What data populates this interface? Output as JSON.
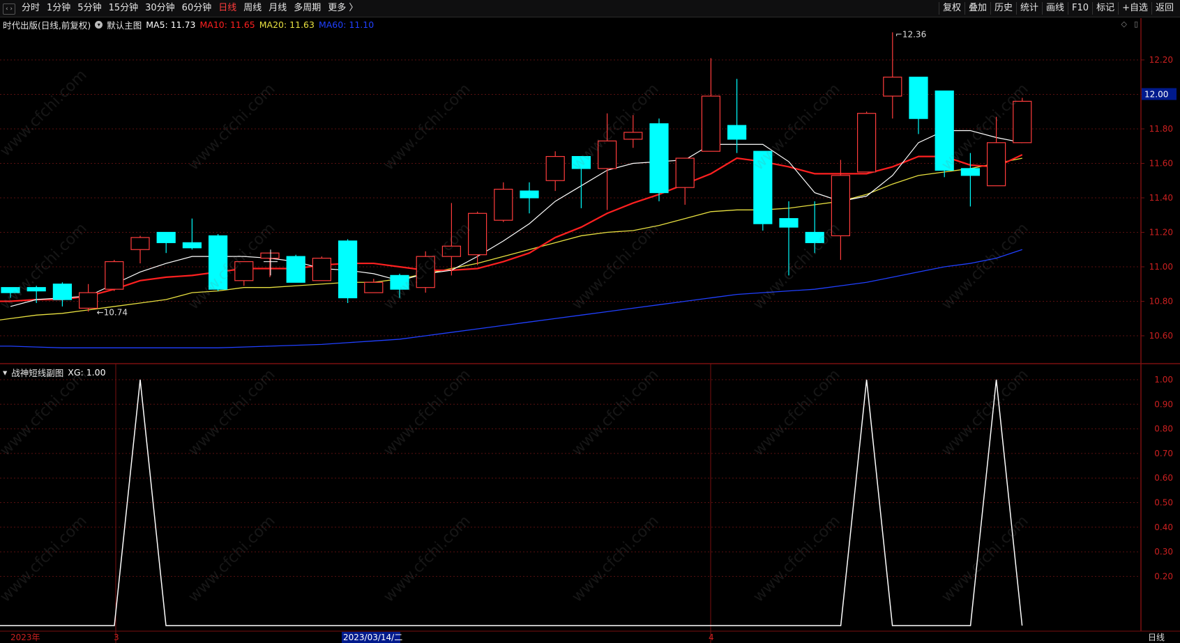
{
  "toolbar": {
    "tabs": [
      "分时",
      "1分钟",
      "5分钟",
      "15分钟",
      "30分钟",
      "60分钟",
      "日线",
      "周线",
      "月线",
      "多周期",
      "更多 〉"
    ],
    "active_tab": "日线",
    "tools": [
      "复权",
      "叠加",
      "历史",
      "统计",
      "画线",
      "F10",
      "标记",
      "+自选",
      "返回"
    ]
  },
  "main_legend": {
    "stock": "时代出版(日线,前复权)",
    "template": "默认主图",
    "ma5": "MA5: 11.73",
    "ma10": "MA10: 11.65",
    "ma20": "MA20: 11.63",
    "ma60": "MA60: 11.10"
  },
  "sub_legend": {
    "name": "战神短线副图",
    "xg": "XG: 1.00"
  },
  "colors": {
    "up": "#ff3c3c",
    "down": "#00ffff",
    "ma5": "#ffffff",
    "ma10": "#ff2020",
    "ma20": "#e8e040",
    "ma60": "#2040ff"
  },
  "price_tag": "12.00",
  "high_label": "12.36",
  "low_label": "10.74",
  "x_labels": [
    "2023年",
    "3",
    "2023/03/14/二",
    "4"
  ],
  "period_label": "日线",
  "watermark": "www.cfchi.com",
  "chart_data": [
    {
      "type": "candlestick",
      "y_ticks": [
        12.2,
        12.0,
        11.8,
        11.6,
        11.4,
        11.2,
        11.0,
        10.8,
        10.6
      ],
      "ylim": [
        10.54,
        12.48
      ],
      "candles": [
        {
          "o": 10.88,
          "h": 10.88,
          "l": 10.82,
          "c": 10.85
        },
        {
          "o": 10.88,
          "h": 10.89,
          "l": 10.79,
          "c": 10.86
        },
        {
          "o": 10.9,
          "h": 10.91,
          "l": 10.77,
          "c": 10.81
        },
        {
          "o": 10.76,
          "h": 10.9,
          "l": 10.74,
          "c": 10.85
        },
        {
          "o": 10.87,
          "h": 11.04,
          "l": 10.86,
          "c": 11.03
        },
        {
          "o": 11.1,
          "h": 11.18,
          "l": 11.02,
          "c": 11.17
        },
        {
          "o": 11.2,
          "h": 11.2,
          "l": 11.08,
          "c": 11.14
        },
        {
          "o": 11.14,
          "h": 11.28,
          "l": 11.1,
          "c": 11.11
        },
        {
          "o": 11.18,
          "h": 11.19,
          "l": 10.86,
          "c": 10.87
        },
        {
          "o": 10.92,
          "h": 11.03,
          "l": 10.89,
          "c": 11.03
        },
        {
          "o": 11.05,
          "h": 11.08,
          "l": 10.94,
          "c": 11.08
        },
        {
          "o": 11.06,
          "h": 11.07,
          "l": 10.91,
          "c": 10.91
        },
        {
          "o": 10.92,
          "h": 11.06,
          "l": 10.92,
          "c": 11.05
        },
        {
          "o": 11.15,
          "h": 11.16,
          "l": 10.79,
          "c": 10.82
        },
        {
          "o": 10.85,
          "h": 10.93,
          "l": 10.85,
          "c": 10.91
        },
        {
          "o": 10.95,
          "h": 10.96,
          "l": 10.82,
          "c": 10.87
        },
        {
          "o": 10.88,
          "h": 11.09,
          "l": 10.85,
          "c": 11.06
        },
        {
          "o": 11.06,
          "h": 11.37,
          "l": 10.95,
          "c": 11.12
        },
        {
          "o": 11.07,
          "h": 11.32,
          "l": 11.01,
          "c": 11.31
        },
        {
          "o": 11.27,
          "h": 11.49,
          "l": 11.26,
          "c": 11.45
        },
        {
          "o": 11.44,
          "h": 11.49,
          "l": 11.31,
          "c": 11.4
        },
        {
          "o": 11.5,
          "h": 11.67,
          "l": 11.44,
          "c": 11.64
        },
        {
          "o": 11.64,
          "h": 11.64,
          "l": 11.34,
          "c": 11.57
        },
        {
          "o": 11.57,
          "h": 11.89,
          "l": 11.33,
          "c": 11.73
        },
        {
          "o": 11.74,
          "h": 11.88,
          "l": 11.69,
          "c": 11.78
        },
        {
          "o": 11.83,
          "h": 11.86,
          "l": 11.38,
          "c": 11.43
        },
        {
          "o": 11.46,
          "h": 11.63,
          "l": 11.36,
          "c": 11.63
        },
        {
          "o": 11.67,
          "h": 12.21,
          "l": 11.67,
          "c": 11.99
        },
        {
          "o": 11.82,
          "h": 12.09,
          "l": 11.66,
          "c": 11.74
        },
        {
          "o": 11.67,
          "h": 11.66,
          "l": 11.21,
          "c": 11.25
        },
        {
          "o": 11.28,
          "h": 11.38,
          "l": 10.95,
          "c": 11.23
        },
        {
          "o": 11.2,
          "h": 11.38,
          "l": 11.08,
          "c": 11.14
        },
        {
          "o": 11.18,
          "h": 11.62,
          "l": 11.04,
          "c": 11.53
        },
        {
          "o": 11.55,
          "h": 11.9,
          "l": 11.55,
          "c": 11.89
        },
        {
          "o": 11.99,
          "h": 12.36,
          "l": 11.86,
          "c": 12.1
        },
        {
          "o": 12.1,
          "h": 12.1,
          "l": 11.77,
          "c": 11.86
        },
        {
          "o": 12.02,
          "h": 12.02,
          "l": 11.52,
          "c": 11.56
        },
        {
          "o": 11.57,
          "h": 11.66,
          "l": 11.35,
          "c": 11.53
        },
        {
          "o": 11.47,
          "h": 11.87,
          "l": 11.47,
          "c": 11.72
        },
        {
          "o": 11.72,
          "h": 11.98,
          "l": 11.72,
          "c": 11.96
        }
      ],
      "ma5": [
        10.77,
        10.81,
        10.82,
        10.83,
        10.9,
        10.97,
        11.02,
        11.06,
        11.06,
        11.06,
        11.05,
        11.03,
        10.99,
        10.98,
        10.96,
        10.92,
        10.96,
        10.98,
        11.06,
        11.15,
        11.25,
        11.38,
        11.47,
        11.56,
        11.6,
        11.61,
        11.62,
        11.71,
        11.71,
        11.71,
        11.61,
        11.43,
        11.38,
        11.41,
        11.53,
        11.72,
        11.79,
        11.79,
        11.75,
        11.72
      ],
      "ma10": [
        10.8,
        10.8,
        10.81,
        10.81,
        10.83,
        10.87,
        10.92,
        10.94,
        10.95,
        10.97,
        10.99,
        10.99,
        10.99,
        11.01,
        11.02,
        11.02,
        11.0,
        10.98,
        10.98,
        10.99,
        11.03,
        11.08,
        11.17,
        11.23,
        11.31,
        11.37,
        11.42,
        11.48,
        11.54,
        11.63,
        11.61,
        11.58,
        11.54,
        11.54,
        11.54,
        11.58,
        11.64,
        11.64,
        11.59,
        11.58,
        11.65
      ],
      "ma20": [
        10.68,
        10.7,
        10.72,
        10.73,
        10.75,
        10.77,
        10.79,
        10.81,
        10.85,
        10.86,
        10.88,
        10.88,
        10.89,
        10.9,
        10.91,
        10.91,
        10.93,
        10.96,
        10.99,
        11.02,
        11.06,
        11.1,
        11.14,
        11.18,
        11.2,
        11.21,
        11.24,
        11.28,
        11.32,
        11.33,
        11.33,
        11.34,
        11.36,
        11.38,
        11.42,
        11.48,
        11.53,
        11.55,
        11.57,
        11.6,
        11.63
      ],
      "ma60": [
        10.54,
        10.54,
        10.535,
        10.53,
        10.53,
        10.53,
        10.53,
        10.53,
        10.53,
        10.53,
        10.535,
        10.54,
        10.545,
        10.55,
        10.56,
        10.57,
        10.58,
        10.6,
        10.62,
        10.64,
        10.66,
        10.68,
        10.7,
        10.72,
        10.74,
        10.76,
        10.78,
        10.8,
        10.82,
        10.84,
        10.85,
        10.86,
        10.87,
        10.89,
        10.91,
        10.94,
        10.97,
        11.0,
        11.02,
        11.05,
        11.1
      ]
    },
    {
      "type": "line",
      "name": "XG",
      "y_ticks": [
        1.0,
        0.9,
        0.8,
        0.7,
        0.6,
        0.5,
        0.4,
        0.3,
        0.2
      ],
      "ylim": [
        0,
        1.0
      ],
      "values": [
        0,
        0,
        0,
        0,
        0,
        1,
        0,
        0,
        0,
        0,
        0,
        0,
        0,
        0,
        0,
        0,
        0,
        0,
        0,
        0,
        0,
        0,
        0,
        0,
        0,
        0,
        0,
        0,
        0,
        0,
        0,
        0,
        0,
        1,
        0,
        0,
        0,
        0,
        1
      ]
    }
  ]
}
